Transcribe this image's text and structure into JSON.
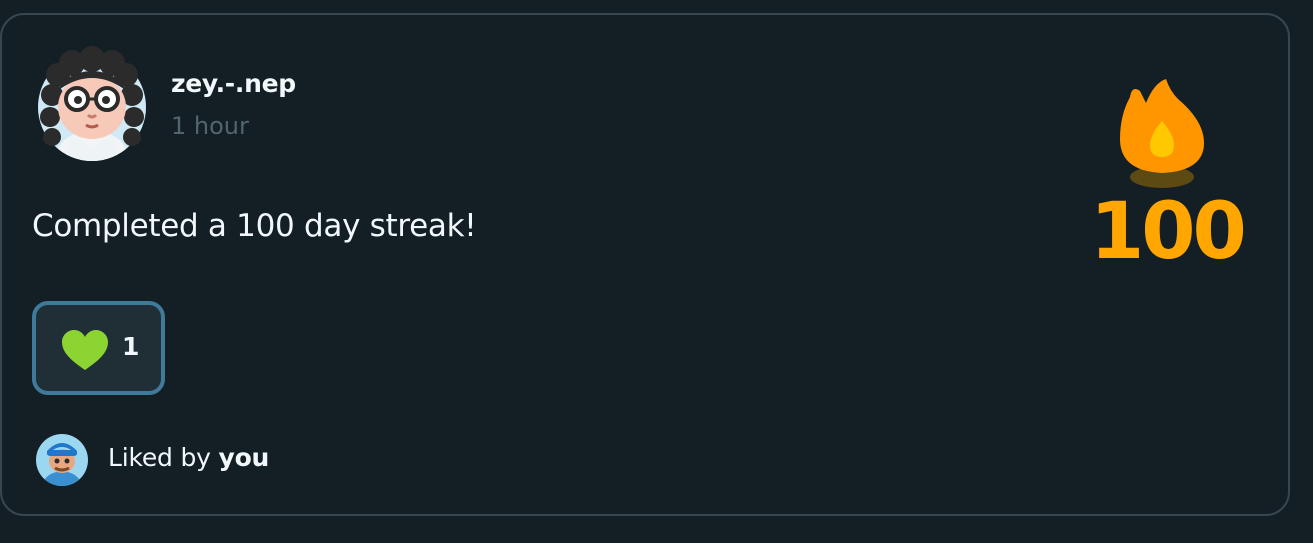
{
  "post": {
    "username": "zey.-.nep",
    "timestamp": "1 hour",
    "message": "Completed a 100 day streak!",
    "streak_count": "100",
    "avatar_icon": "user-avatar-glasses-curly-hair",
    "streak_icon": "fire-flame-icon"
  },
  "reactions": {
    "like_count": "1",
    "like_icon": "heart-icon",
    "like_color": "#8bd432",
    "liked_by_prefix": "Liked by",
    "liked_by_user": "you",
    "liker_avatar_icon": "user-avatar-cap"
  },
  "colors": {
    "background": "#131f24",
    "border": "#37464f",
    "streak_orange": "#ffa600",
    "button_border": "#3f7a9b"
  }
}
